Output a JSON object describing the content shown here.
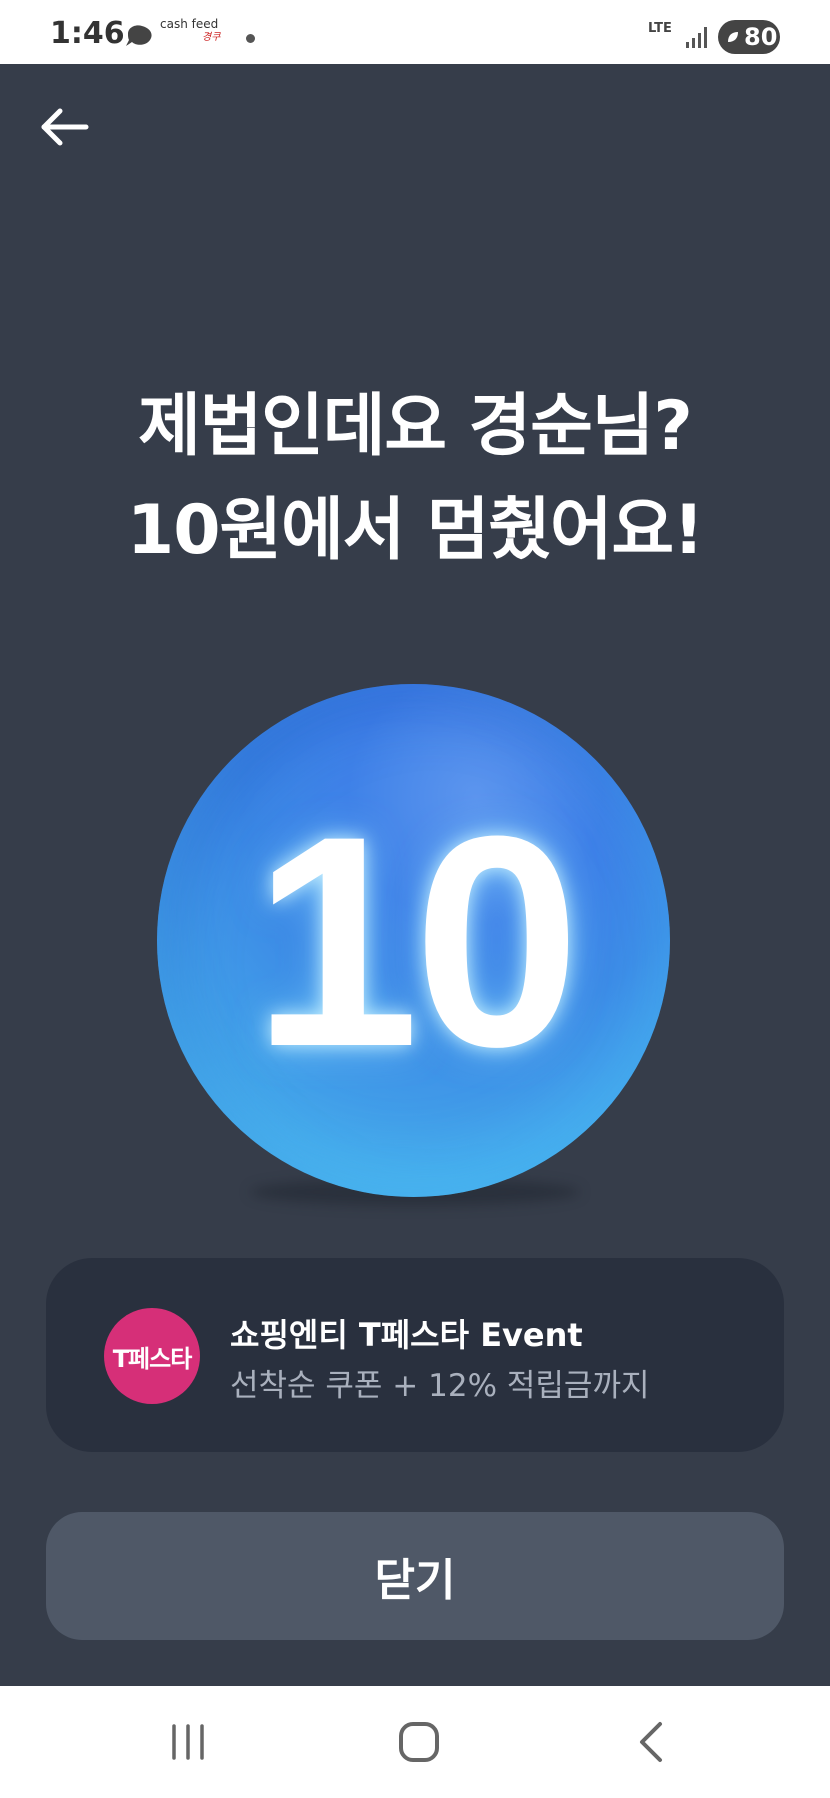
{
  "status_bar": {
    "time": "1:46",
    "app_cashfeed": "cash feed",
    "app_small": "경쿠",
    "network": "LTE",
    "battery": "80"
  },
  "headline": {
    "line1": "제법인데요 경순님?",
    "line2": "10원에서 멈췄어요!"
  },
  "ball": {
    "value": "10",
    "color_top": "#3f82e8",
    "color_bottom": "#56c6f0"
  },
  "promo": {
    "logo_text": "T페스타",
    "title": "쇼핑엔티 T페스타 Event",
    "subtitle": "선착순 쿠폰 + 12% 적립금까지",
    "logo_color": "#d62f78"
  },
  "close_button": {
    "label": "닫기"
  },
  "colors": {
    "background": "#363d4a",
    "card": "#29303e",
    "button": "#4f5867"
  },
  "icons": {
    "back": "arrow-left-icon",
    "nav_recent": "recent-apps-icon",
    "nav_home": "home-icon",
    "nav_back": "nav-back-icon"
  }
}
